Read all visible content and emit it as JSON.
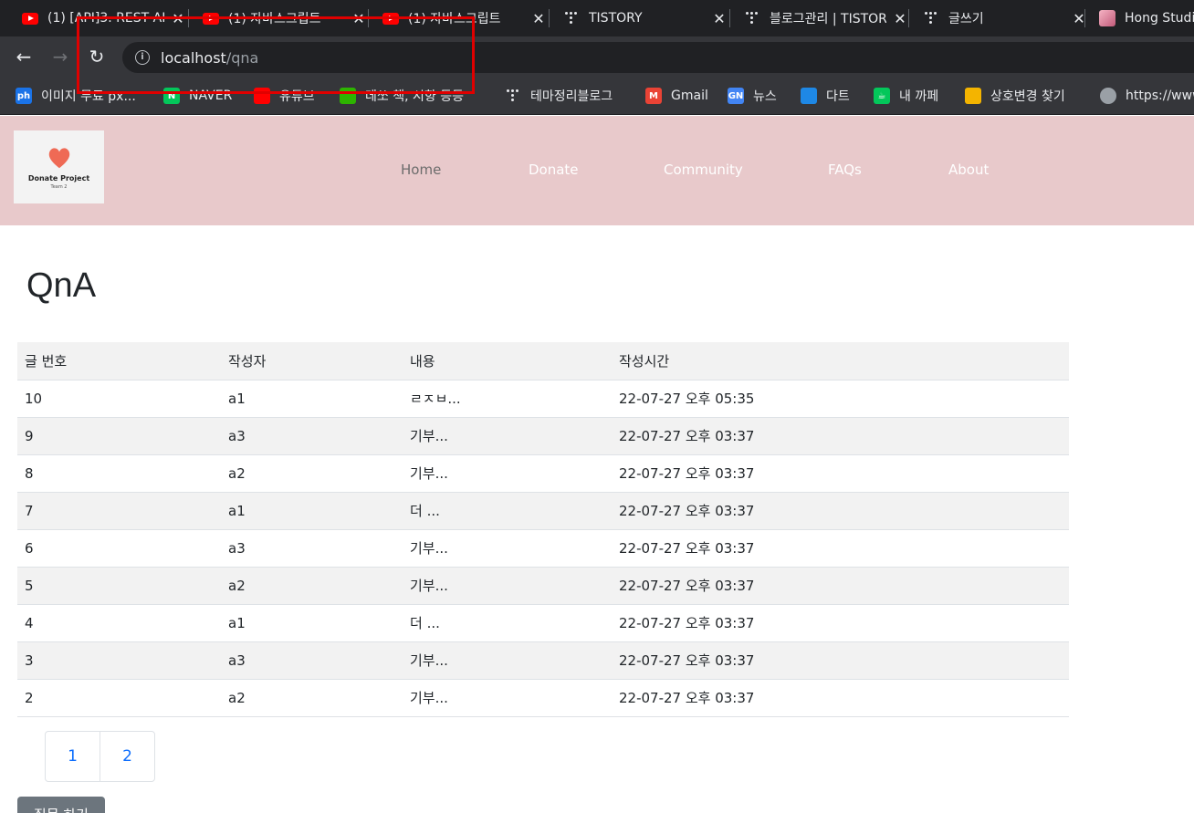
{
  "browser": {
    "tabs": [
      {
        "title": "(1) [API]3. REST API",
        "icon": "youtube-icon",
        "has_close": true
      },
      {
        "title": "(1) 자바스크립트",
        "icon": "youtube-icon",
        "has_close": true
      },
      {
        "title": "(1) 자바스크립트",
        "icon": "youtube-icon",
        "has_close": true
      },
      {
        "title": "TISTORY",
        "icon": "tistory-icon",
        "has_close": true
      },
      {
        "title": "블로그관리 | TISTORY",
        "icon": "tistory-icon",
        "has_close": true
      },
      {
        "title": "글쓰기",
        "icon": "tistory-icon",
        "has_close": true
      },
      {
        "title": "Hong Studio",
        "icon": "profile-icon",
        "has_close": false
      }
    ],
    "close_glyph": "✕",
    "url_host": "localhost",
    "url_path": "/qna",
    "bookmarks": [
      {
        "label": "이미지 무료 px...",
        "icon": "ph",
        "color": "#1a73e8"
      },
      {
        "label": "NAVER",
        "icon": "N",
        "color": "#03c75a"
      },
      {
        "label": "유튜브",
        "icon": "",
        "color": "#ff0000"
      },
      {
        "label": "데쏘 책, 시향 등등",
        "icon": "",
        "color": "#2db400"
      },
      {
        "label": "테마정리블로그",
        "icon": "tistory",
        "color": ""
      },
      {
        "label": "Gmail",
        "icon": "M",
        "color": "#ea4335"
      },
      {
        "label": "뉴스",
        "icon": "GN",
        "color": "#4285f4"
      },
      {
        "label": "다트",
        "icon": "",
        "color": "#1e88e5"
      },
      {
        "label": "내 까페",
        "icon": "☕",
        "color": "#03c75a"
      },
      {
        "label": "상호변경 찾기",
        "icon": "",
        "color": "#f4b400"
      },
      {
        "label": "https://www",
        "icon": "globe",
        "color": "#9aa0a6"
      }
    ]
  },
  "site": {
    "logo_title": "Donate Project",
    "logo_sub": "Team 2",
    "nav": [
      {
        "label": "Home",
        "active": true
      },
      {
        "label": "Donate",
        "active": false
      },
      {
        "label": "Community",
        "active": false
      },
      {
        "label": "FAQs",
        "active": false
      },
      {
        "label": "About",
        "active": false
      }
    ]
  },
  "page": {
    "title": "QnA",
    "table": {
      "headers": [
        "글 번호",
        "작성자",
        "내용",
        "작성시간"
      ],
      "rows": [
        [
          "10",
          "a1",
          "ㄹㅈㅂ...",
          "22-07-27 오후 05:35"
        ],
        [
          "9",
          "a3",
          "기부...",
          "22-07-27 오후 03:37"
        ],
        [
          "8",
          "a2",
          "기부...",
          "22-07-27 오후 03:37"
        ],
        [
          "7",
          "a1",
          "더 ...",
          "22-07-27 오후 03:37"
        ],
        [
          "6",
          "a3",
          "기부...",
          "22-07-27 오후 03:37"
        ],
        [
          "5",
          "a2",
          "기부...",
          "22-07-27 오후 03:37"
        ],
        [
          "4",
          "a1",
          "더 ...",
          "22-07-27 오후 03:37"
        ],
        [
          "3",
          "a3",
          "기부...",
          "22-07-27 오후 03:37"
        ],
        [
          "2",
          "a2",
          "기부...",
          "22-07-27 오후 03:37"
        ]
      ]
    },
    "pages": [
      "1",
      "2"
    ],
    "ask_button": "질문 하기"
  },
  "colors": {
    "header_bg": "#e8c9cb",
    "link_blue": "#0d6efd",
    "button_gray": "#6c757d",
    "annotation_red": "#e00000"
  }
}
